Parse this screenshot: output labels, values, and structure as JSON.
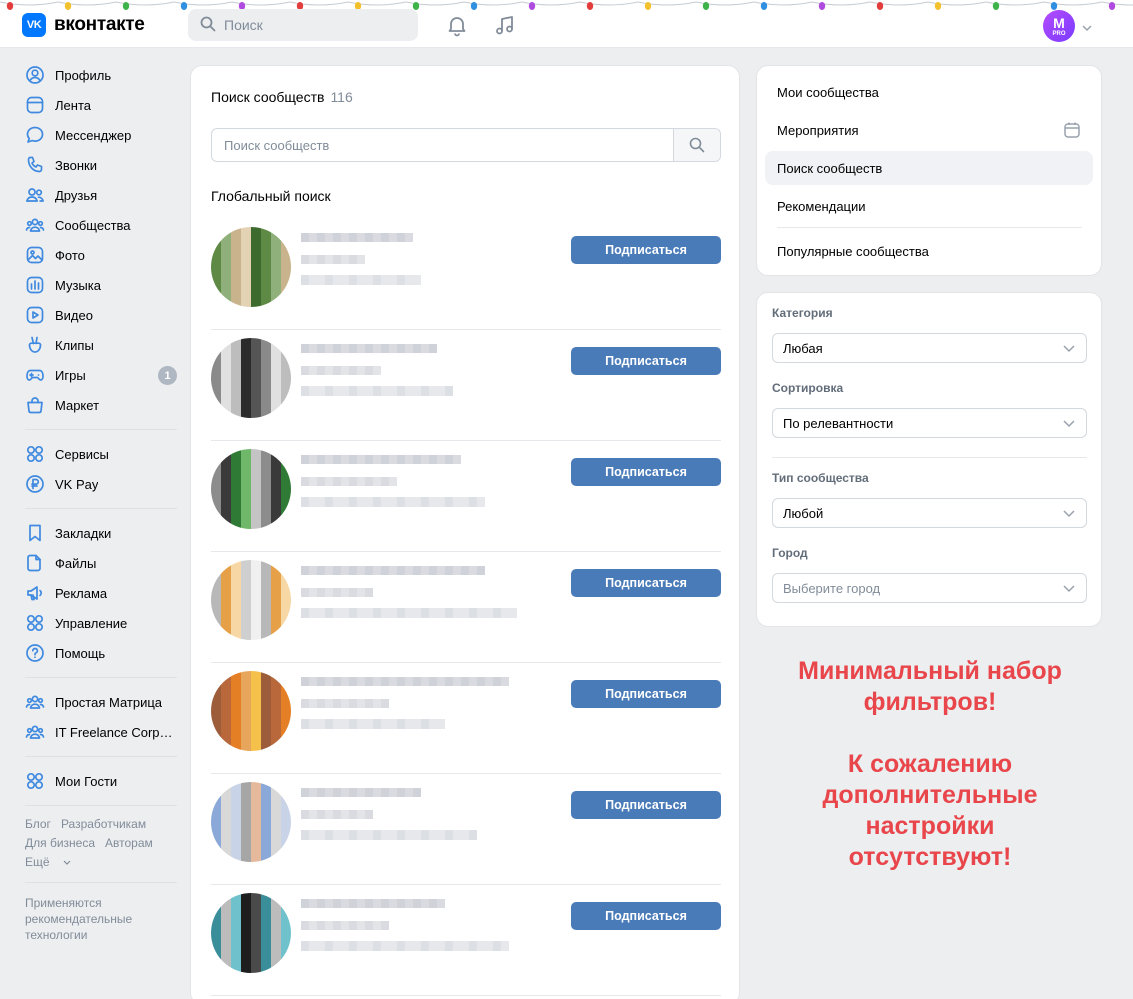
{
  "header": {
    "logo_mark": "VK",
    "logo_text": "вконтакте",
    "search_placeholder": "Поиск",
    "avatar_letter": "M",
    "avatar_badge": "PRO"
  },
  "sidebar": {
    "group1": [
      {
        "label": "Профиль",
        "icon": "user-circle-icon"
      },
      {
        "label": "Лента",
        "icon": "newsfeed-icon"
      },
      {
        "label": "Мессенджер",
        "icon": "message-icon"
      },
      {
        "label": "Звонки",
        "icon": "phone-icon"
      },
      {
        "label": "Друзья",
        "icon": "friends-icon"
      },
      {
        "label": "Сообщества",
        "icon": "communities-icon"
      },
      {
        "label": "Фото",
        "icon": "photo-icon"
      },
      {
        "label": "Музыка",
        "icon": "music-icon"
      },
      {
        "label": "Видео",
        "icon": "video-icon"
      },
      {
        "label": "Клипы",
        "icon": "clips-icon"
      },
      {
        "label": "Игры",
        "icon": "games-icon",
        "badge": "1"
      },
      {
        "label": "Маркет",
        "icon": "market-icon"
      }
    ],
    "group2": [
      {
        "label": "Сервисы",
        "icon": "services-icon"
      },
      {
        "label": "VK Pay",
        "icon": "vkpay-icon"
      }
    ],
    "group3": [
      {
        "label": "Закладки",
        "icon": "bookmark-icon"
      },
      {
        "label": "Файлы",
        "icon": "file-icon"
      },
      {
        "label": "Реклама",
        "icon": "megaphone-icon"
      },
      {
        "label": "Управление",
        "icon": "manage-icon"
      },
      {
        "label": "Помощь",
        "icon": "help-icon"
      }
    ],
    "group4": [
      {
        "label": "Простая Матрица",
        "icon": "communities-icon"
      },
      {
        "label": "IT Freelance Corporation",
        "icon": "communities-icon"
      }
    ],
    "group5": [
      {
        "label": "Мои Гости",
        "icon": "services-icon"
      }
    ],
    "footer_links": [
      "Блог",
      "Разработчикам",
      "Для бизнеса",
      "Авторам",
      "Ещё"
    ],
    "footer_note": "Применяются рекомендательные технологии"
  },
  "main": {
    "title": "Поиск сообществ",
    "count": "116",
    "search_placeholder": "Поиск сообществ",
    "section_title": "Глобальный поиск",
    "subscribe_label": "Подписаться",
    "rows": [
      {
        "palette": [
          "#5e8a45",
          "#c9b38c",
          "#3d6b2e",
          "#8fb07a",
          "#e3d2b4"
        ]
      },
      {
        "palette": [
          "#2b2b2b",
          "#8a8a8a",
          "#bdbdbd",
          "#555555",
          "#e0e0e0"
        ]
      },
      {
        "palette": [
          "#3a3a3a",
          "#6fb86a",
          "#8c8c8c",
          "#2f7a34",
          "#c4c4c4"
        ]
      },
      {
        "palette": [
          "#f0f0f0",
          "#e5a048",
          "#cfcfcf",
          "#b8b8b8",
          "#f7d8a5"
        ]
      },
      {
        "palette": [
          "#e47f25",
          "#f5c14a",
          "#b9683c",
          "#e7a65c",
          "#9d5d3a"
        ]
      },
      {
        "palette": [
          "#8aa8d8",
          "#c9d3e8",
          "#e4b99c",
          "#d8d8d8",
          "#a6a6a6"
        ]
      },
      {
        "palette": [
          "#1e1e1e",
          "#3a8e9a",
          "#6fc2cb",
          "#4a4a4a",
          "#bcbcbc"
        ]
      }
    ]
  },
  "right_nav": {
    "items": [
      "Мои сообщества",
      "Мероприятия",
      "Поиск сообществ",
      "Рекомендации",
      "Популярные сообщества"
    ]
  },
  "filters": {
    "category_label": "Категория",
    "category_value": "Любая",
    "sort_label": "Сортировка",
    "sort_value": "По релевантности",
    "type_label": "Тип сообщества",
    "type_value": "Любой",
    "city_label": "Город",
    "city_placeholder": "Выберите город"
  },
  "annotation": {
    "line1": "Минимальный набор",
    "line2": "фильтров!",
    "line3": "К сожалению",
    "line4": "дополнительные",
    "line5": "настройки",
    "line6": "отсутствуют!"
  },
  "colors": {
    "accent": "#0077ff",
    "button": "#4a7bb9",
    "annotation": "#e8464b",
    "icon_blue": "#3f8ae0"
  }
}
